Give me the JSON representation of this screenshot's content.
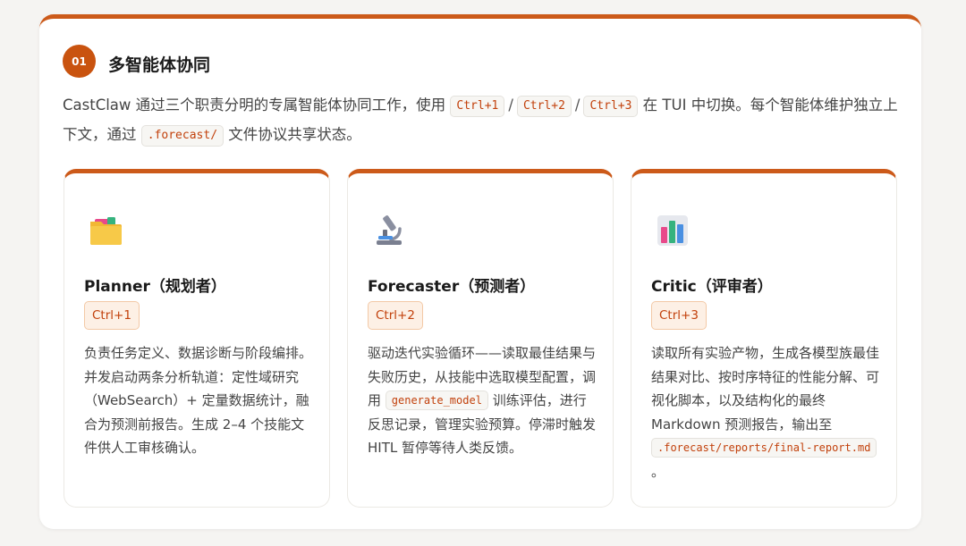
{
  "section": {
    "number": "01",
    "title": "多智能体协同"
  },
  "intro": {
    "part1": "CastClaw 通过三个职责分明的专属智能体协同工作，使用 ",
    "key1": "Ctrl+1",
    "sep1": "/",
    "key2": "Ctrl+2",
    "sep2": "/",
    "key3": "Ctrl+3",
    "part2": " 在 TUI 中切换。每个智能体维护独立上下文，通过 ",
    "path": ".forecast/",
    "part3": " 文件协议共享状态。"
  },
  "agents": [
    {
      "icon": "folder-icon",
      "name": "Planner（规划者）",
      "shortcut": "Ctrl+1",
      "description": "负责任务定义、数据诊断与阶段编排。并发启动两条分析轨道：定性域研究（WebSearch）+ 定量数据统计，融合为预测前报告。生成 2–4 个技能文件供人工审核确认。"
    },
    {
      "icon": "microscope-icon",
      "name": "Forecaster（预测者）",
      "shortcut": "Ctrl+2",
      "description_before": "驱动迭代实验循环——读取最佳结果与失败历史，从技能中选取模型配置，调用 ",
      "description_code": "generate_model",
      "description_after": " 训练评估，进行反思记录，管理实验预算。停滞时触发 HITL 暂停等待人类反馈。"
    },
    {
      "icon": "bar-chart-icon",
      "name": "Critic（评审者）",
      "shortcut": "Ctrl+3",
      "description_before": "读取所有实验产物，生成各模型族最佳结果对比、按时序特征的性能分解、可视化脚本，以及结构化的最终 Markdown 预测报告，输出至 ",
      "description_code": ".forecast/reports/final-report.md",
      "description_after": "。"
    }
  ]
}
